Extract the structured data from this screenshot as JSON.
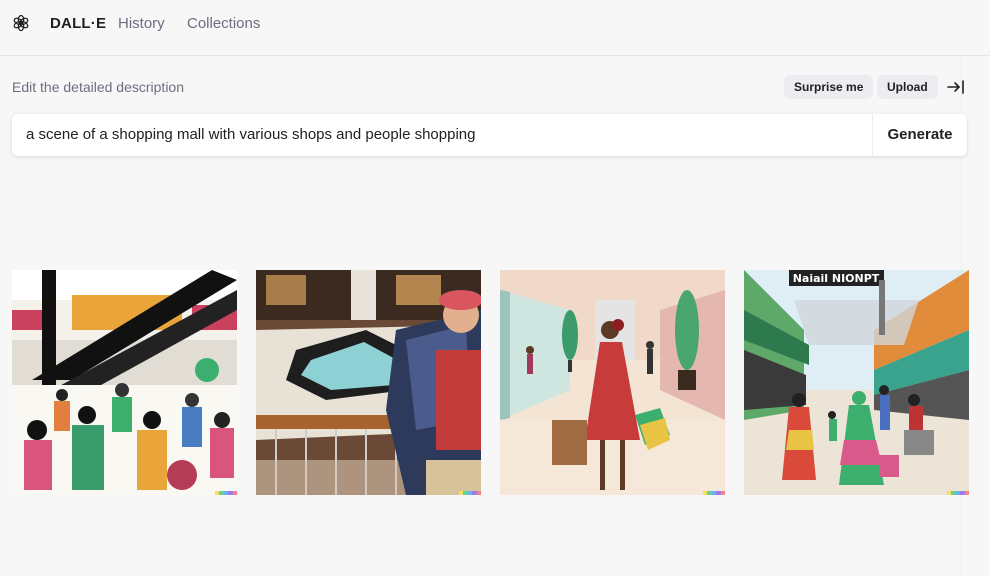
{
  "header": {
    "brand": "DALL·E",
    "nav": [
      "History",
      "Collections"
    ],
    "logo_icon": "openai-logo-icon"
  },
  "editor": {
    "subheading": "Edit the detailed description",
    "surprise_label": "Surprise me",
    "upload_label": "Upload",
    "collapse_icon": "arrow-to-right-icon",
    "prompt_value": "a scene of a shopping mall with various shops and people shopping",
    "generate_label": "Generate"
  },
  "results": {
    "images": [
      "crowd-escalator-illustration",
      "man-at-fountain-railing-photo",
      "woman-red-dress-shopping-bags-illustration",
      "people-walking-outdoor-market-illustration"
    ],
    "sign_text": "Naiail NIONPT"
  },
  "colors": {
    "background": "#f7f7f8",
    "text_primary": "#202123",
    "text_secondary": "#6e6e80",
    "pill_bg": "#ececf1",
    "signature": [
      "#f6e05e",
      "#68d391",
      "#63b3ed",
      "#9f7aea",
      "#fc8181"
    ]
  }
}
